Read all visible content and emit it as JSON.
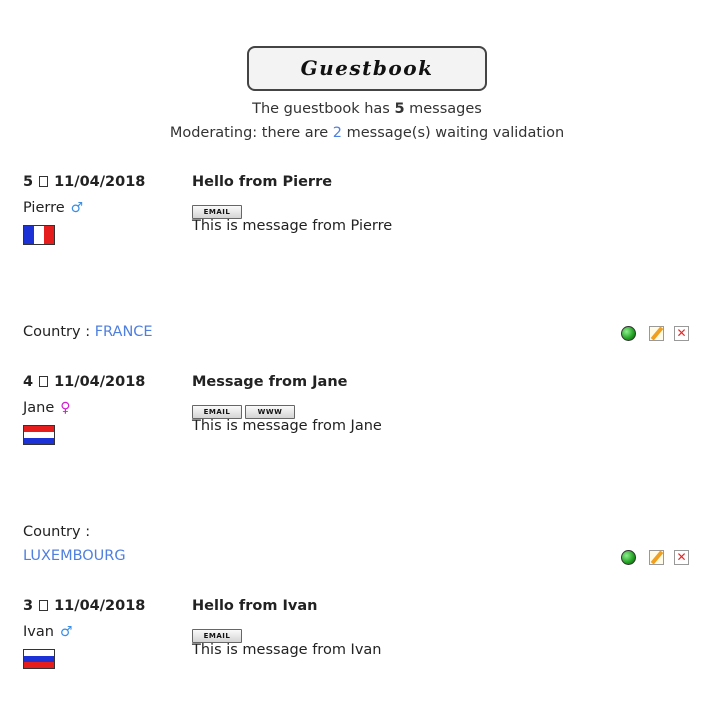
{
  "header": {
    "title": "Guestbook",
    "summary_prefix": "The guestbook has ",
    "summary_count": "5",
    "summary_suffix": " messages",
    "moderation_prefix": "Moderating: there are ",
    "moderation_count": "2",
    "moderation_suffix": " message(s) waiting validation"
  },
  "entries": [
    {
      "number": "5",
      "date": "11/04/2018",
      "author": "Pierre",
      "gender_symbol": "♂",
      "flag": "france",
      "subject": "Hello from Pierre",
      "email_label": "EMAIL",
      "message": "This is message from Pierre",
      "country_label": "Country :",
      "country": "FRANCE"
    },
    {
      "number": "4",
      "date": "11/04/2018",
      "author": "Jane",
      "gender_symbol": "♀",
      "flag": "luxembourg",
      "subject": "Message from Jane",
      "email_label": "EMAIL",
      "www_label": "WWW",
      "message": "This is message from Jane",
      "country_label": "Country :",
      "country": "LUXEMBOURG"
    },
    {
      "number": "3",
      "date": "11/04/2018",
      "author": "Ivan",
      "gender_symbol": "♂",
      "flag": "russia",
      "subject": "Hello from Ivan",
      "email_label": "EMAIL",
      "message": "This is message from Ivan"
    }
  ],
  "colors": {
    "link": "#4f7fe0",
    "male": "#3a8ee6",
    "female": "#d11fd1",
    "approve": "#20a020",
    "delete": "#e22222"
  },
  "icons": {
    "approve": "green-dot-icon",
    "edit": "edit-pencil-icon",
    "delete": "delete-x-icon",
    "document": "document-icon"
  }
}
